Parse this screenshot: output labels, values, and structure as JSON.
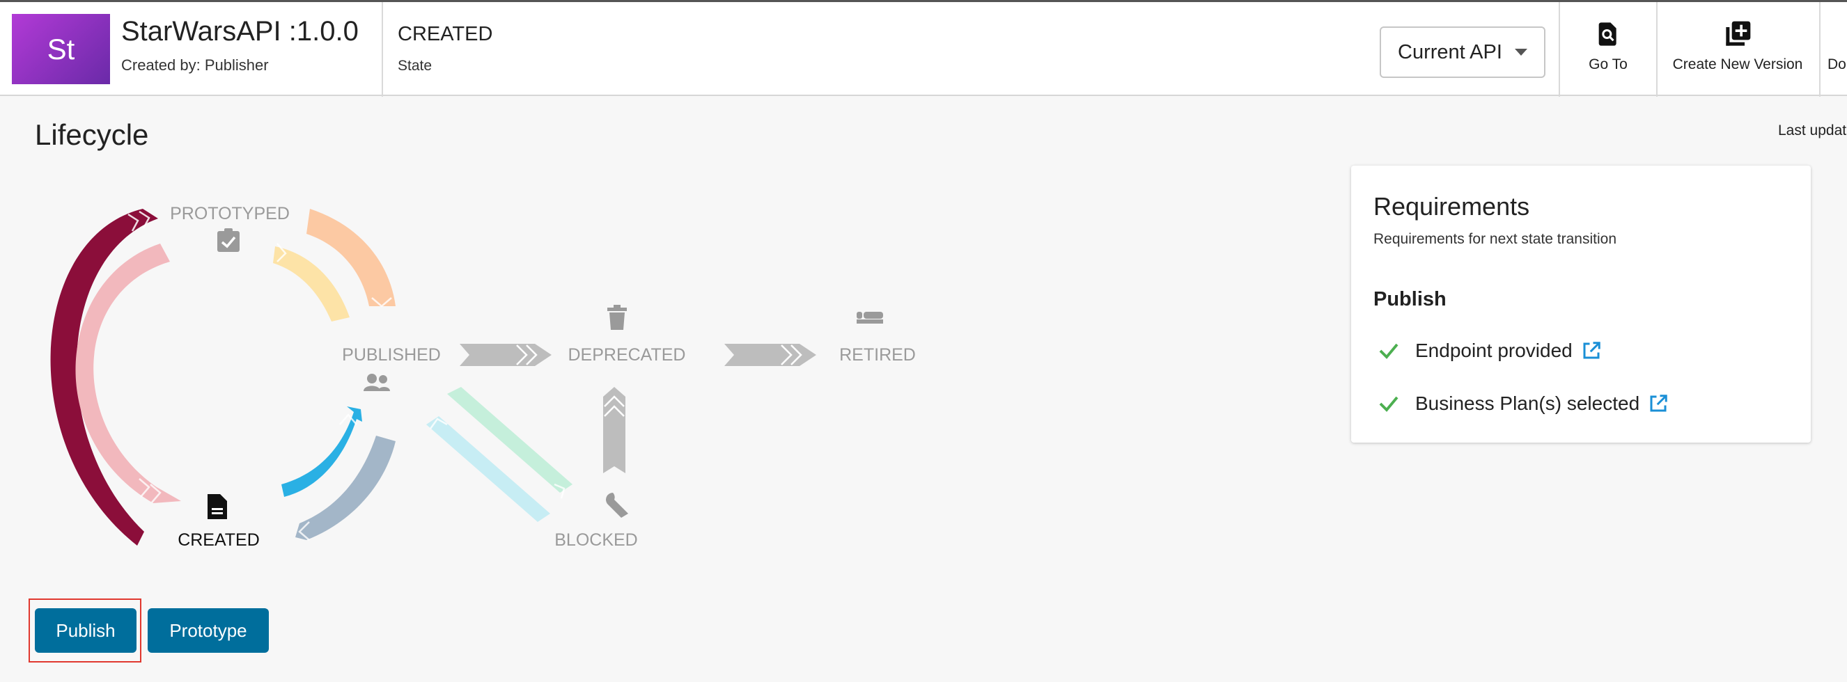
{
  "header": {
    "avatar_text": "St",
    "api_name": "StarWarsAPI :1.0.0",
    "created_by": "Created by: Publisher",
    "state_value": "CREATED",
    "state_label": "State",
    "version_select": "Current API",
    "go_to_label": "Go To",
    "create_version_label": "Create New Version",
    "truncated_action_label": "Do"
  },
  "page": {
    "title": "Lifecycle",
    "last_updated": "Last updat"
  },
  "lifecycle": {
    "current_state": "CREATED",
    "states": {
      "prototyped": "PROTOTYPED",
      "published": "PUBLISHED",
      "deprecated": "DEPRECATED",
      "retired": "RETIRED",
      "created": "CREATED",
      "blocked": "BLOCKED"
    }
  },
  "requirements": {
    "title": "Requirements",
    "subtitle": "Requirements for next state transition",
    "section": "Publish",
    "items": [
      {
        "label": "Endpoint provided"
      },
      {
        "label": "Business Plan(s) selected"
      }
    ]
  },
  "actions": {
    "publish": "Publish",
    "prototype": "Prototype"
  },
  "colors": {
    "brand_button": "#006e9c",
    "check_green": "#4caf50",
    "link_blue": "#1a8fd6",
    "focus_outline": "#e0382f"
  }
}
